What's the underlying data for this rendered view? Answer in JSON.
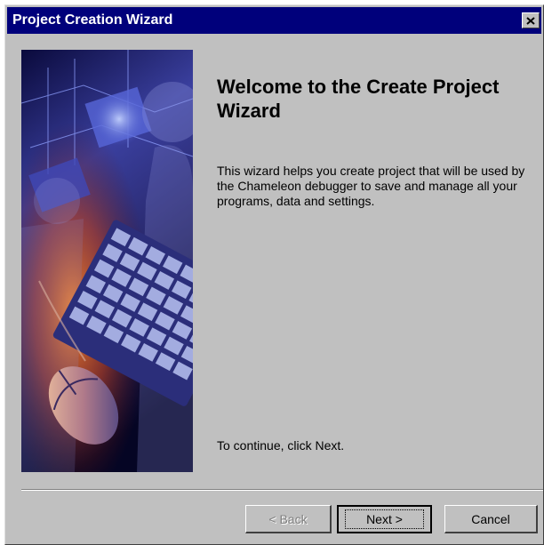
{
  "window": {
    "title": "Project Creation Wizard"
  },
  "icons": {
    "close": "close-icon",
    "side_image": "computer-hardware-illustration"
  },
  "content": {
    "heading": "Welcome to the Create Project Wizard",
    "intro": "This wizard helps you create project that will be used by the Chameleon debugger to save and manage all your programs, data and settings.",
    "continue_hint": "To continue, click Next."
  },
  "buttons": {
    "back_label": "< Back",
    "next_label": "Next >",
    "cancel_label": "Cancel",
    "back_enabled": false,
    "default": "next"
  },
  "colors": {
    "title_bar": "#00007b",
    "dialog_face": "#c0c0c0",
    "disabled_text": "#808080"
  }
}
